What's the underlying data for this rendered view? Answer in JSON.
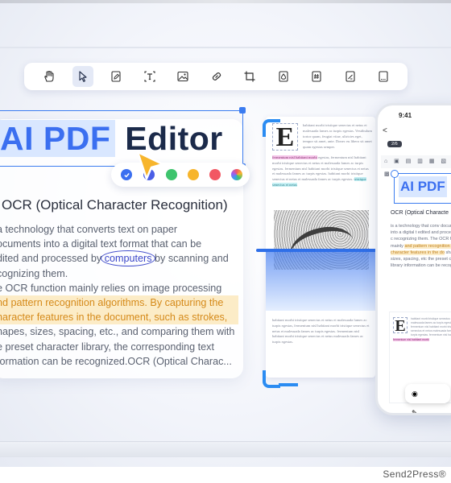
{
  "toolbar": {
    "tools": [
      {
        "name": "hand-tool",
        "icon": "hand-icon"
      },
      {
        "name": "select-tool",
        "icon": "cursor-icon",
        "active": true
      },
      {
        "name": "edit-tool",
        "icon": "pencil-page-icon"
      },
      {
        "name": "text-tool",
        "icon": "text-box-icon"
      },
      {
        "name": "image-tool",
        "icon": "image-icon"
      },
      {
        "name": "link-tool",
        "icon": "link-icon"
      },
      {
        "name": "crop-tool",
        "icon": "crop-icon"
      },
      {
        "name": "watermark-tool",
        "icon": "drop-icon"
      },
      {
        "name": "header-footer-tool",
        "icon": "hash-page-icon"
      },
      {
        "name": "form-tool",
        "icon": "doc-lines-icon"
      },
      {
        "name": "page-tool",
        "icon": "page-dashed-icon"
      }
    ]
  },
  "editor": {
    "title_highlight": "AI PDF",
    "title_rest": " Editor",
    "palette": [
      "#3b6ff0",
      "#4a5ee6",
      "#3ec46d",
      "#f7b52c",
      "#f25763",
      "rainbow"
    ],
    "ocr_heading": "OCR (Optical Character Recognition)",
    "ocr_lines": [
      {
        "text": "a technology that converts text on paper",
        "hl": false
      },
      {
        "text": "ocuments into a digital text format that can be",
        "hl": false
      },
      {
        "text": "dited and processed by ",
        "circled": "computers",
        "after": " by scanning and",
        "hl": false
      },
      {
        "text": "cognizing them.",
        "hl": false
      },
      {
        "text": "e OCR function mainly relies on image processing",
        "hl": false
      },
      {
        "text": "nd pattern recognition algorithms. By capturing the",
        "hl": true
      },
      {
        "text": "haracter features in the document, such as strokes,",
        "hl": true
      },
      {
        "text": "hapes, sizes, spacing, etc., and comparing them with",
        "hl": false
      },
      {
        "text": "e preset character library, the corresponding text",
        "hl": false
      },
      {
        "text": "formation can be recognized.OCR (Optical Charac...",
        "hl": false
      }
    ]
  },
  "document": {
    "drop_cap": "E",
    "text_a": "habitant morbi tristique senectus et netus et malesuada fames ac turpis egestas. Vestibulum tortor quam, feugiat vitae, ultricies eget, tempor sit amet, ante. Donec eu libero sit amet quam egestas semper.",
    "text_b": "egestas, fermentum nisl habitant morbi tristique senectus et netus et malesuada fames ac turpis egestas. fermentum nisl habitant morbi tristique senectus et netus et malesuada fames ac turpis egestas. habitant morbi tristique senectus et netus et malesuada fames ac turpis egestas.",
    "text_c": "habitant morbi tristique senectus et netus et malesuada fames ac turpis egestas, fermentum nisl habitant morbi tristique senectus et netus et malesuada fames ac turpis egestas. fermentum nisl habitant morbi tristique senectus et netus malesuada fames ac turpis egestas."
  },
  "phone": {
    "time": "9:41",
    "back": "<",
    "page_badge": "2/6",
    "tools_row": "⌂ ▣ ▤ ▥ ▦ ▧ ▨ ▩",
    "title": "AI PDF",
    "ocr_heading": "OCR (Optical Characte",
    "body_plain_1": "is a technology that conv documents into a digital t edited and processed by c recognizing them. The OCR function mainly",
    "body_hl": "and pattern recognition alg character features in the do",
    "body_plain_2": "shapes, sizes, spacing, etc the preset character library information can be recogni",
    "drop_cap": "E",
    "doc_text": "habitant morbi tristique senectus et netus et malesuada fames ac turpis egestas, fermentum nisl habitant morbi tristique senectus et netus malesuada fames ac turpis egestas. fermentum nisl habitant morbi.",
    "bottom_tools": "◉ ✎"
  },
  "footer": {
    "credit": "Send2Press®"
  }
}
